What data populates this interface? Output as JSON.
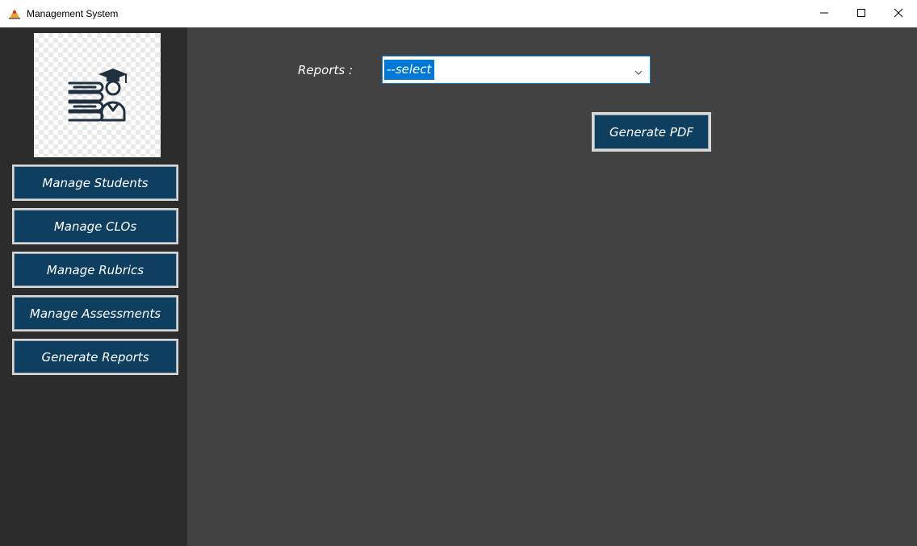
{
  "window": {
    "title": "Management System",
    "controls": {
      "minimize_icon": "minimize-icon",
      "maximize_icon": "maximize-icon",
      "close_icon": "close-icon"
    }
  },
  "sidebar": {
    "logo_icon": "books-graduate-icon",
    "items": [
      {
        "label": "Manage Students"
      },
      {
        "label": "Manage CLOs"
      },
      {
        "label": "Manage Rubrics"
      },
      {
        "label": "Manage Assessments"
      },
      {
        "label": "Generate Reports"
      }
    ]
  },
  "main": {
    "reports_label": "Reports :",
    "reports_select": {
      "selected": "--select"
    },
    "generate_pdf_label": "Generate PDF"
  },
  "colors": {
    "button_bg": "#0e3f60",
    "sidebar_bg": "#2c2c2c",
    "main_bg": "#424242",
    "selection": "#0078d7"
  }
}
